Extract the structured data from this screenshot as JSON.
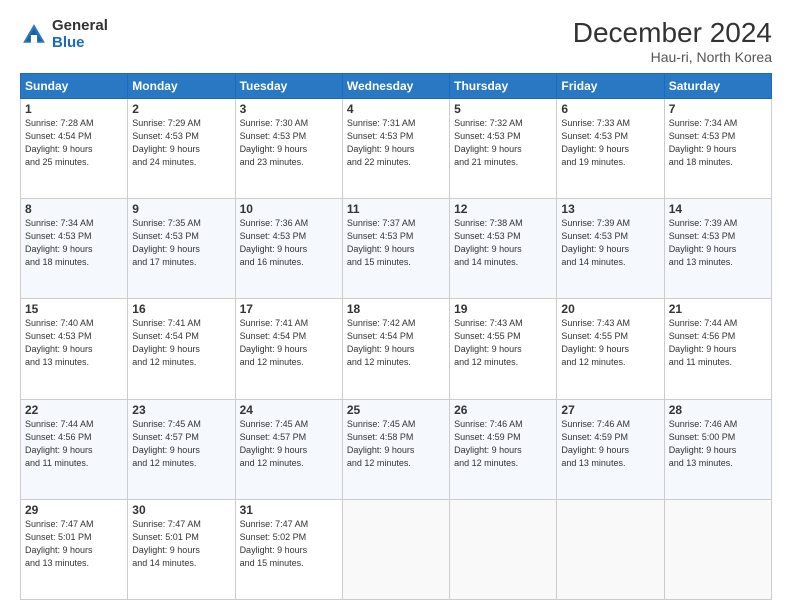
{
  "logo": {
    "line1": "General",
    "line2": "Blue"
  },
  "title": "December 2024",
  "subtitle": "Hau-ri, North Korea",
  "days_header": [
    "Sunday",
    "Monday",
    "Tuesday",
    "Wednesday",
    "Thursday",
    "Friday",
    "Saturday"
  ],
  "weeks": [
    [
      {
        "day": "1",
        "info": "Sunrise: 7:28 AM\nSunset: 4:54 PM\nDaylight: 9 hours\nand 25 minutes."
      },
      {
        "day": "2",
        "info": "Sunrise: 7:29 AM\nSunset: 4:53 PM\nDaylight: 9 hours\nand 24 minutes."
      },
      {
        "day": "3",
        "info": "Sunrise: 7:30 AM\nSunset: 4:53 PM\nDaylight: 9 hours\nand 23 minutes."
      },
      {
        "day": "4",
        "info": "Sunrise: 7:31 AM\nSunset: 4:53 PM\nDaylight: 9 hours\nand 22 minutes."
      },
      {
        "day": "5",
        "info": "Sunrise: 7:32 AM\nSunset: 4:53 PM\nDaylight: 9 hours\nand 21 minutes."
      },
      {
        "day": "6",
        "info": "Sunrise: 7:33 AM\nSunset: 4:53 PM\nDaylight: 9 hours\nand 19 minutes."
      },
      {
        "day": "7",
        "info": "Sunrise: 7:34 AM\nSunset: 4:53 PM\nDaylight: 9 hours\nand 18 minutes."
      }
    ],
    [
      {
        "day": "8",
        "info": "Sunrise: 7:34 AM\nSunset: 4:53 PM\nDaylight: 9 hours\nand 18 minutes."
      },
      {
        "day": "9",
        "info": "Sunrise: 7:35 AM\nSunset: 4:53 PM\nDaylight: 9 hours\nand 17 minutes."
      },
      {
        "day": "10",
        "info": "Sunrise: 7:36 AM\nSunset: 4:53 PM\nDaylight: 9 hours\nand 16 minutes."
      },
      {
        "day": "11",
        "info": "Sunrise: 7:37 AM\nSunset: 4:53 PM\nDaylight: 9 hours\nand 15 minutes."
      },
      {
        "day": "12",
        "info": "Sunrise: 7:38 AM\nSunset: 4:53 PM\nDaylight: 9 hours\nand 14 minutes."
      },
      {
        "day": "13",
        "info": "Sunrise: 7:39 AM\nSunset: 4:53 PM\nDaylight: 9 hours\nand 14 minutes."
      },
      {
        "day": "14",
        "info": "Sunrise: 7:39 AM\nSunset: 4:53 PM\nDaylight: 9 hours\nand 13 minutes."
      }
    ],
    [
      {
        "day": "15",
        "info": "Sunrise: 7:40 AM\nSunset: 4:53 PM\nDaylight: 9 hours\nand 13 minutes."
      },
      {
        "day": "16",
        "info": "Sunrise: 7:41 AM\nSunset: 4:54 PM\nDaylight: 9 hours\nand 12 minutes."
      },
      {
        "day": "17",
        "info": "Sunrise: 7:41 AM\nSunset: 4:54 PM\nDaylight: 9 hours\nand 12 minutes."
      },
      {
        "day": "18",
        "info": "Sunrise: 7:42 AM\nSunset: 4:54 PM\nDaylight: 9 hours\nand 12 minutes."
      },
      {
        "day": "19",
        "info": "Sunrise: 7:43 AM\nSunset: 4:55 PM\nDaylight: 9 hours\nand 12 minutes."
      },
      {
        "day": "20",
        "info": "Sunrise: 7:43 AM\nSunset: 4:55 PM\nDaylight: 9 hours\nand 12 minutes."
      },
      {
        "day": "21",
        "info": "Sunrise: 7:44 AM\nSunset: 4:56 PM\nDaylight: 9 hours\nand 11 minutes."
      }
    ],
    [
      {
        "day": "22",
        "info": "Sunrise: 7:44 AM\nSunset: 4:56 PM\nDaylight: 9 hours\nand 11 minutes."
      },
      {
        "day": "23",
        "info": "Sunrise: 7:45 AM\nSunset: 4:57 PM\nDaylight: 9 hours\nand 12 minutes."
      },
      {
        "day": "24",
        "info": "Sunrise: 7:45 AM\nSunset: 4:57 PM\nDaylight: 9 hours\nand 12 minutes."
      },
      {
        "day": "25",
        "info": "Sunrise: 7:45 AM\nSunset: 4:58 PM\nDaylight: 9 hours\nand 12 minutes."
      },
      {
        "day": "26",
        "info": "Sunrise: 7:46 AM\nSunset: 4:59 PM\nDaylight: 9 hours\nand 12 minutes."
      },
      {
        "day": "27",
        "info": "Sunrise: 7:46 AM\nSunset: 4:59 PM\nDaylight: 9 hours\nand 13 minutes."
      },
      {
        "day": "28",
        "info": "Sunrise: 7:46 AM\nSunset: 5:00 PM\nDaylight: 9 hours\nand 13 minutes."
      }
    ],
    [
      {
        "day": "29",
        "info": "Sunrise: 7:47 AM\nSunset: 5:01 PM\nDaylight: 9 hours\nand 13 minutes."
      },
      {
        "day": "30",
        "info": "Sunrise: 7:47 AM\nSunset: 5:01 PM\nDaylight: 9 hours\nand 14 minutes."
      },
      {
        "day": "31",
        "info": "Sunrise: 7:47 AM\nSunset: 5:02 PM\nDaylight: 9 hours\nand 15 minutes."
      },
      null,
      null,
      null,
      null
    ]
  ]
}
